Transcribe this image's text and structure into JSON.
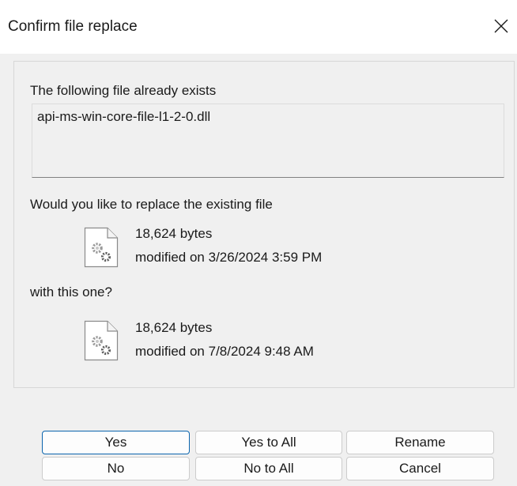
{
  "window": {
    "title": "Confirm file replace"
  },
  "message": {
    "exists_text": "The following file already exists",
    "filename": "api-ms-win-core-file-l1-2-0.dll",
    "replace_question": "Would you like to replace the existing file",
    "with_text": "with this one?"
  },
  "existing_file": {
    "size": "18,624 bytes",
    "modified": "modified on 3/26/2024 3:59 PM"
  },
  "new_file": {
    "size": "18,624 bytes",
    "modified": "modified on 7/8/2024 9:48 AM"
  },
  "buttons": {
    "yes": "Yes",
    "yes_to_all": "Yes to All",
    "rename": "Rename",
    "no": "No",
    "no_to_all": "No to All",
    "cancel": "Cancel"
  },
  "icons": {
    "close": "close-icon",
    "file": "settings-file-icon"
  },
  "colors": {
    "default_button_border": "#0a64ad",
    "dialog_background": "#f0f0f0"
  }
}
